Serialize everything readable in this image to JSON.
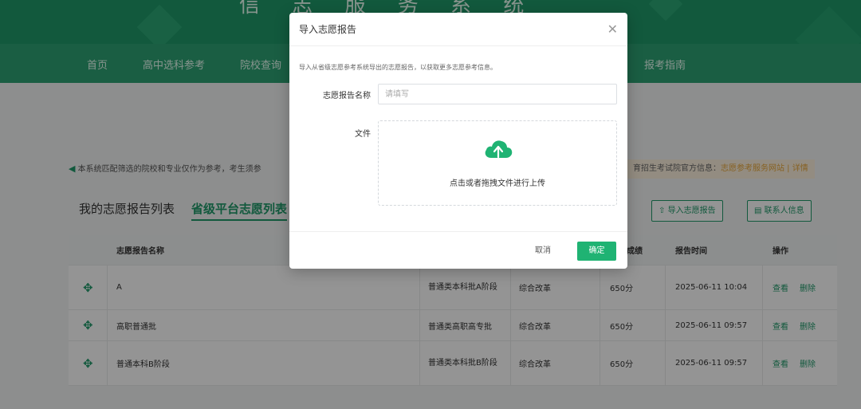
{
  "banner": {
    "title": "信 志 服 务 系 统"
  },
  "nav": {
    "items": [
      "首页",
      "高中选科参考",
      "院校查询",
      "报考指南"
    ]
  },
  "notice": {
    "left": "本系统匹配筛选的院校和专业仅作为参考，考生须参",
    "right_prefix": "育招生考试院官方信息：",
    "right_link": "志愿参考服务网站 | 详情"
  },
  "tabs": {
    "mine": "我的志愿报告列表",
    "provincial": "省级平台志愿列表"
  },
  "header_buttons": {
    "import": "导入志愿报告",
    "contact": "联系人信息"
  },
  "table": {
    "headers": {
      "name": "志愿报告名称",
      "score": "成绩",
      "time": "报告时间",
      "ops": "操作"
    },
    "rows": [
      {
        "name": "A",
        "batch": "普通类本科批A阶段",
        "type": "综合改革",
        "score": "650分",
        "time": "2025-06-11 10:04",
        "view": "查看",
        "delete": "删除"
      },
      {
        "name": "高职普通批",
        "batch": "普通类高职高专批",
        "type": "综合改革",
        "score": "650分",
        "time": "2025-06-11 09:57",
        "view": "查看",
        "delete": "删除"
      },
      {
        "name": "普通本科B阶段",
        "batch": "普通类本科批B阶段",
        "type": "综合改革",
        "score": "650分",
        "time": "2025-06-11 09:57",
        "view": "查看",
        "delete": "删除"
      }
    ]
  },
  "modal": {
    "title": "导入志愿报告",
    "tip": "导入从省级志愿参考系统导出的志愿报告，以获取更多志愿参考信息。",
    "name_label": "志愿报告名称",
    "name_placeholder": "请填写",
    "file_label": "文件",
    "upload_text": "点击或者拖拽文件进行上传",
    "cancel": "取消",
    "ok": "确定"
  },
  "colors": {
    "brand": "#1f9a6a",
    "primary_button": "#1fb373"
  }
}
